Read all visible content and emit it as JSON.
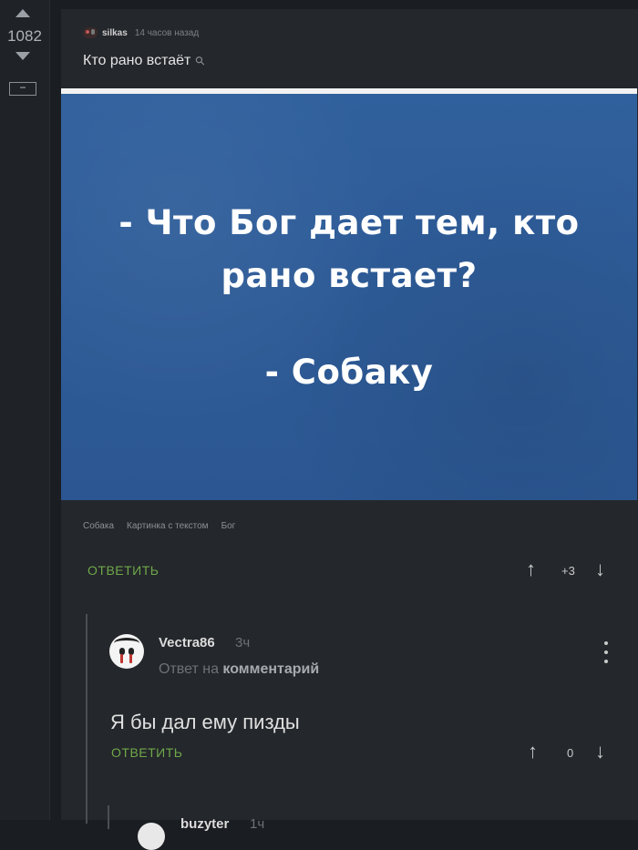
{
  "post": {
    "rating": "1082",
    "collapse": "−",
    "author": "silkas",
    "time": "14 часов назад",
    "title": "Кто рано встаёт",
    "image": {
      "line1": "- Что Бог дает тем, кто",
      "line2": "рано встает?",
      "line3": "- Собаку"
    },
    "tags": [
      "Собака",
      "Картинка с текстом",
      "Бог"
    ],
    "reply_label": "ОТВЕТИТЬ",
    "score": "+3"
  },
  "comment": {
    "author": "Vectra86",
    "time": "3ч",
    "reply_to_prefix": "Ответ на",
    "reply_to_link": "комментарий",
    "text": "Я бы дал ему пизды",
    "reply_label": "ОТВЕТИТЬ",
    "score": "0"
  },
  "next_comment": {
    "author": "buzyter",
    "time": "1ч"
  },
  "icons": {
    "up": "arrow-up-icon",
    "down": "arrow-down-icon",
    "link": "link-icon",
    "more": "kebab-icon"
  },
  "colors": {
    "accent_green": "#6fa84a",
    "background": "#1a1d21",
    "card": "#24272b",
    "image_blue": "#2e5a96"
  }
}
